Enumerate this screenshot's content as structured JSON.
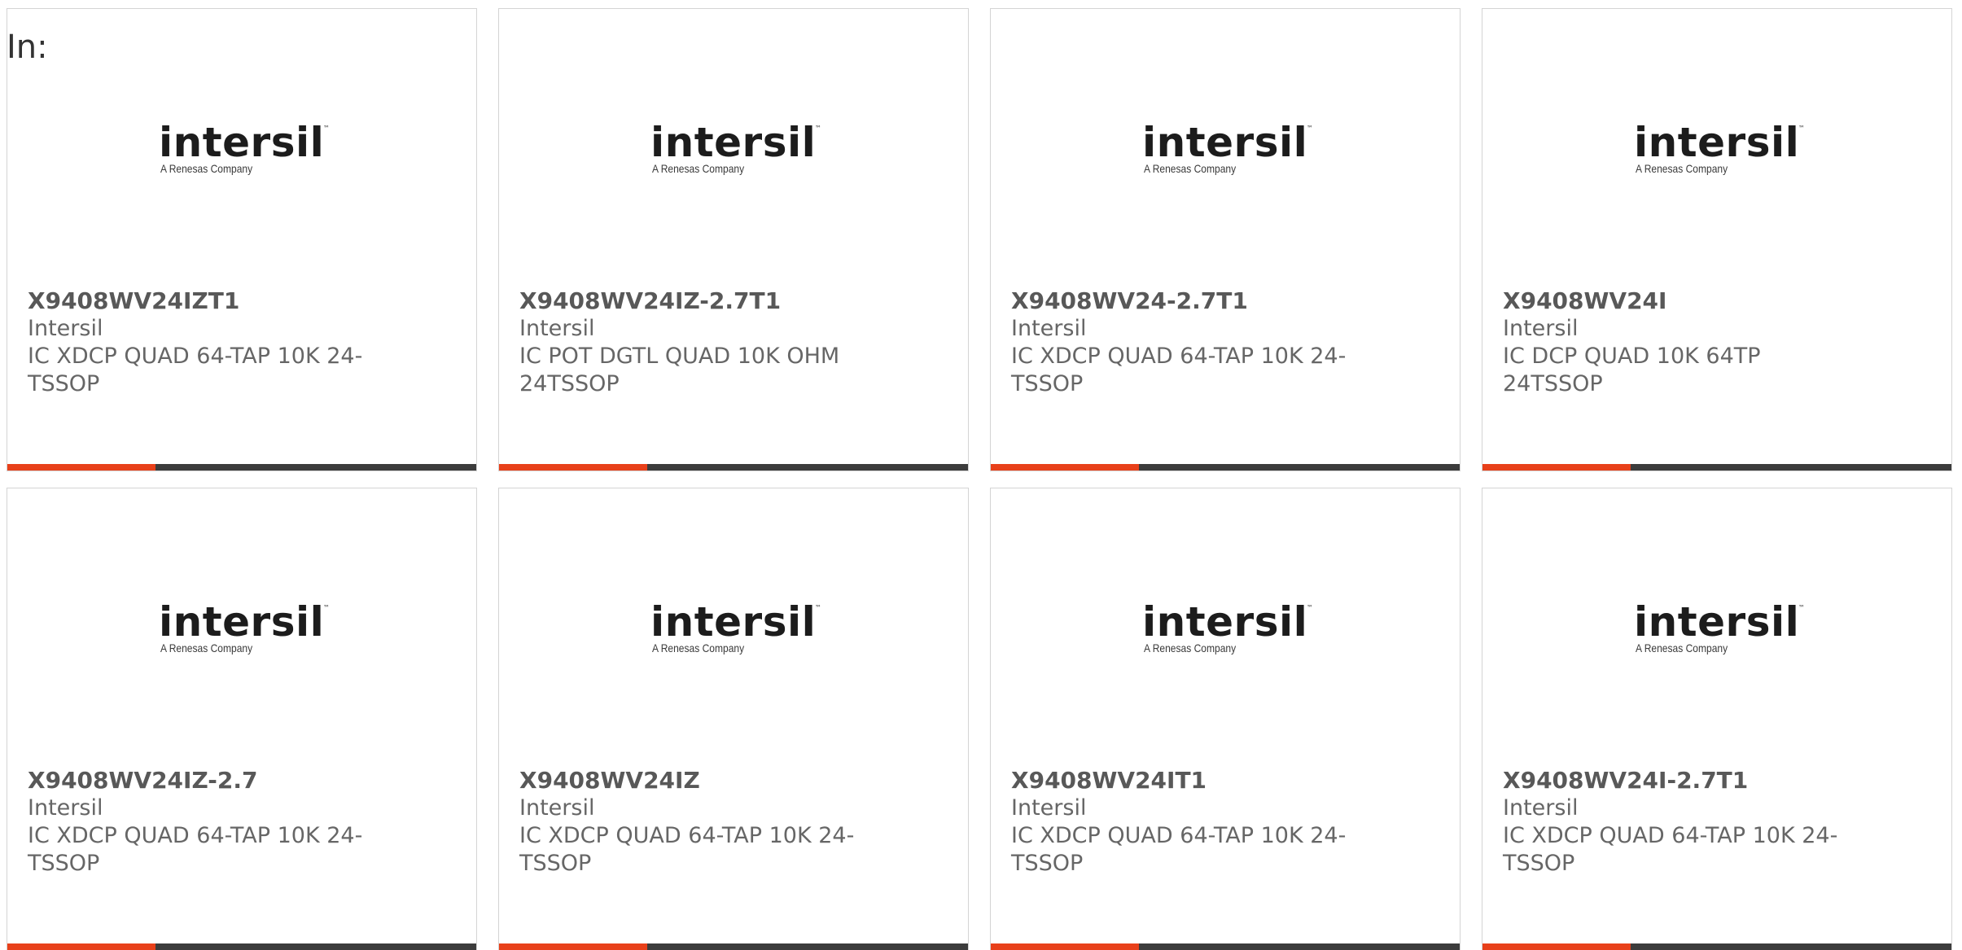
{
  "header": {
    "label": "In:"
  },
  "accent_color": "#e8401a",
  "logo": {
    "name": "intersil-logo",
    "word": "intersil",
    "tm": "™",
    "tagline": "A Renesas Company"
  },
  "products": [
    {
      "part": "X9408WV24IZT1",
      "manufacturer": "Intersil",
      "description": "IC XDCP QUAD 64-TAP 10K 24-TSSOP"
    },
    {
      "part": "X9408WV24IZ-2.7T1",
      "manufacturer": "Intersil",
      "description": "IC POT DGTL QUAD 10K OHM 24TSSOP"
    },
    {
      "part": "X9408WV24-2.7T1",
      "manufacturer": "Intersil",
      "description": "IC XDCP QUAD 64-TAP 10K 24-TSSOP"
    },
    {
      "part": "X9408WV24I",
      "manufacturer": "Intersil",
      "description": "IC DCP QUAD 10K 64TP 24TSSOP"
    },
    {
      "part": "X9408WV24IZ-2.7",
      "manufacturer": "Intersil",
      "description": "IC XDCP QUAD 64-TAP 10K 24-TSSOP"
    },
    {
      "part": "X9408WV24IZ",
      "manufacturer": "Intersil",
      "description": "IC XDCP QUAD 64-TAP 10K 24-TSSOP"
    },
    {
      "part": "X9408WV24IT1",
      "manufacturer": "Intersil",
      "description": "IC XDCP QUAD 64-TAP 10K 24-TSSOP"
    },
    {
      "part": "X9408WV24I-2.7T1",
      "manufacturer": "Intersil",
      "description": "IC XDCP QUAD 64-TAP 10K 24-TSSOP"
    }
  ]
}
